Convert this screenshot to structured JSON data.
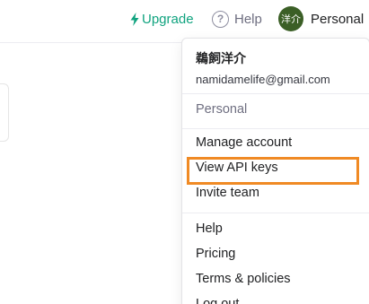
{
  "topbar": {
    "upgrade_label": "Upgrade",
    "help_label": "Help",
    "avatar_text": "洋介",
    "account_label": "Personal"
  },
  "menu": {
    "user_name": "鵜飼洋介",
    "user_email": "namidamelife@gmail.com",
    "org_label": "Personal",
    "items": [
      {
        "label": "Manage account"
      },
      {
        "label": "View API keys"
      },
      {
        "label": "Invite team"
      },
      {
        "label": "Help"
      },
      {
        "label": "Pricing"
      },
      {
        "label": "Terms & policies"
      },
      {
        "label": "Log out"
      }
    ]
  },
  "colors": {
    "accent_green": "#10a37f",
    "avatar_bg": "#3b5f26",
    "highlight_orange": "#f08a24"
  },
  "icons": {
    "upgrade": "lightning-bolt-icon",
    "help": "question-circle-icon"
  }
}
